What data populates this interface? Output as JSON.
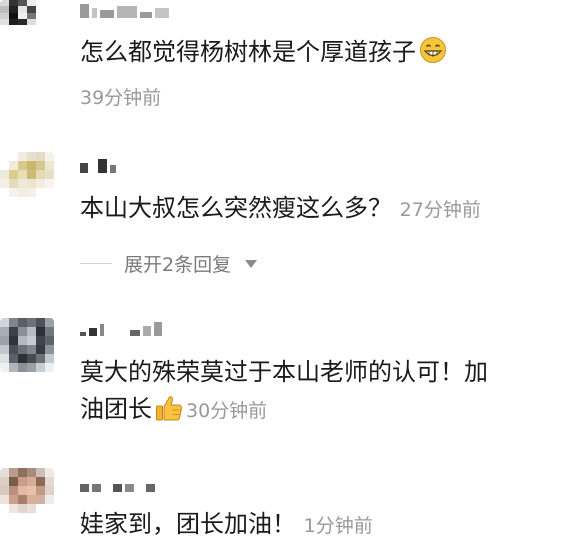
{
  "comments": [
    {
      "text": "怎么都觉得杨树林是个厚道孩子",
      "emoji": "grinning-face-icon",
      "time": "39分钟前"
    },
    {
      "text": "本山大叔怎么突然瘦这么多？",
      "time": "27分钟前",
      "replies_label": "展开2条回复"
    },
    {
      "text_line1": "莫大的殊荣莫过于本山老师的认可！加",
      "text_line2": "油团长",
      "emoji": "thumbs-up-icon",
      "time": "30分钟前"
    },
    {
      "text": "娃家到，团长加油！",
      "time": "1分钟前"
    }
  ],
  "colors": {
    "text": "#1a1a1a",
    "meta": "#999999",
    "reply": "#7a7a7a"
  }
}
